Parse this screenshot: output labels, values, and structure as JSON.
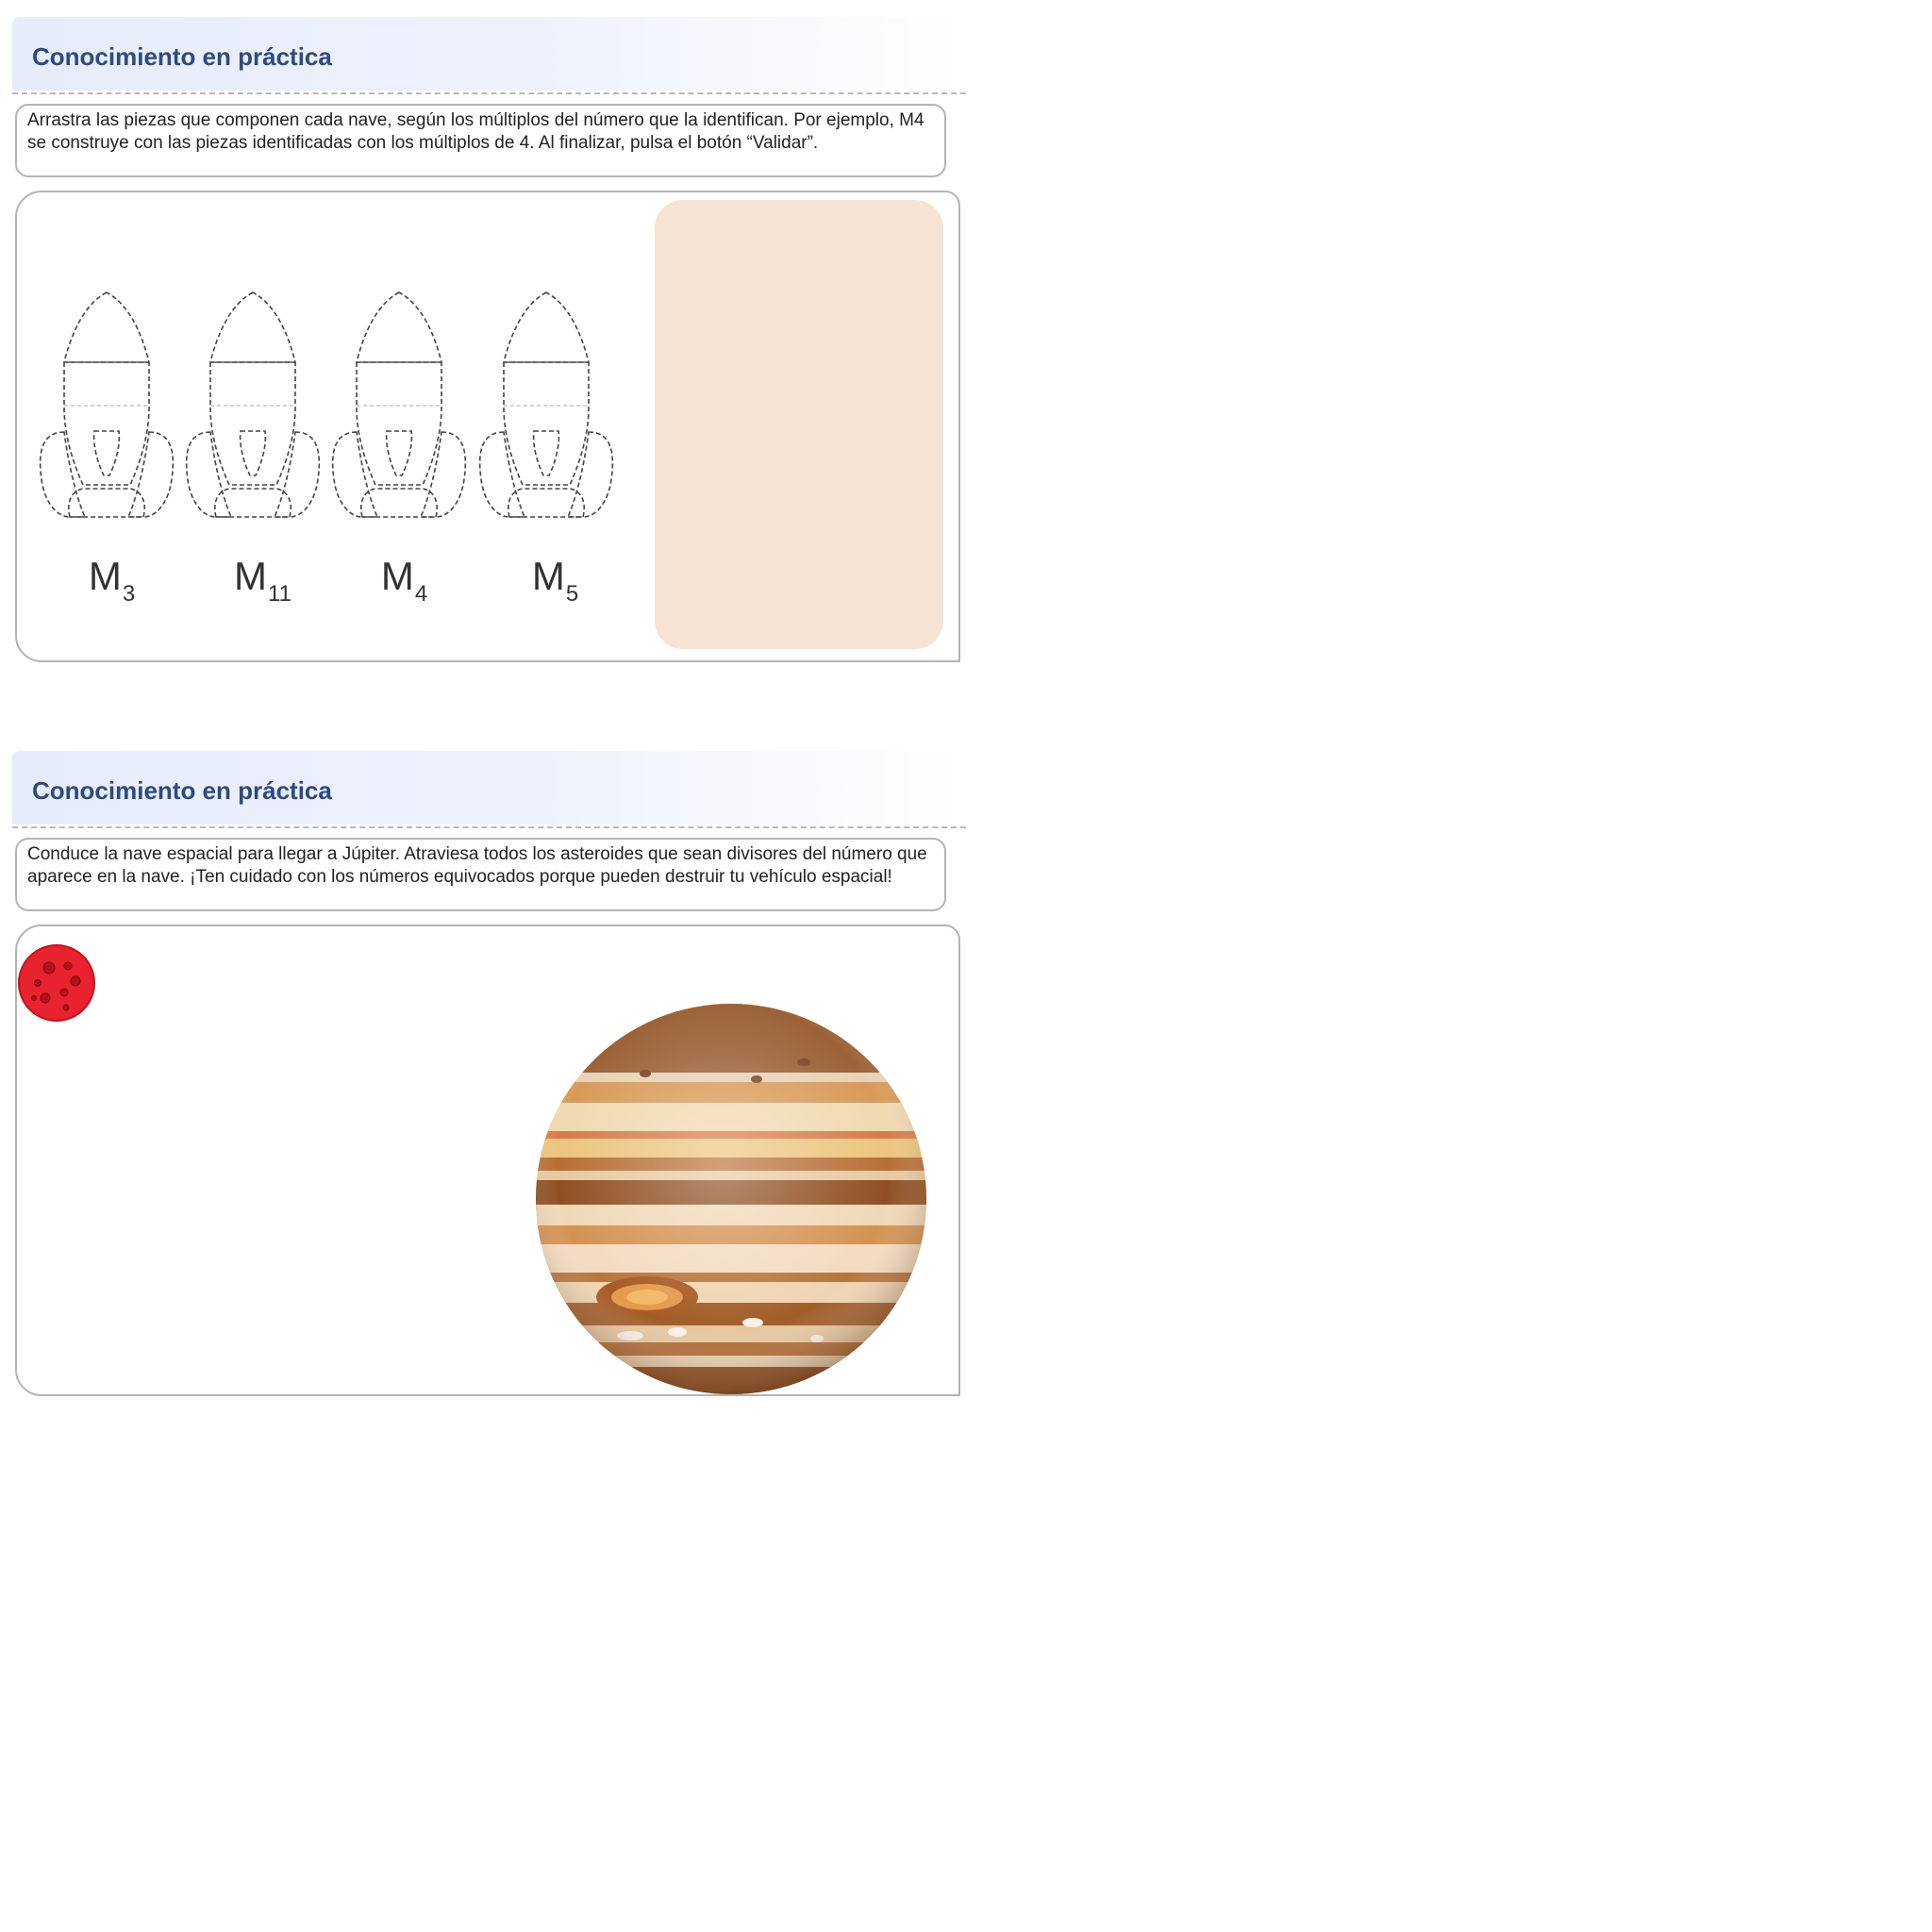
{
  "activity_1": {
    "title": "Conocimiento en práctica",
    "instructions": "Arrastra las piezas que componen cada nave, según los múltiplos del número que la identifican. Por ejemplo, M4 se construye con las piezas identificadas con los múltiplos de 4. Al finalizar, pulsa el botón “Validar”.",
    "rockets": [
      {
        "main": "M",
        "sub": "3"
      },
      {
        "main": "M",
        "sub": "11"
      },
      {
        "main": "M",
        "sub": "4"
      },
      {
        "main": "M",
        "sub": "5"
      }
    ],
    "tray_color": "#f7e3d3"
  },
  "activity_2": {
    "title": "Conocimiento en práctica",
    "instructions": "Conduce la nave espacial para llegar a Júpiter. Atraviesa todos los asteroides que sean divisores del número que aparece en la nave. ¡Ten cuidado con los números equivocados porque pueden destruir tu vehículo espacial!",
    "asteroid_icon": "red-asteroid-icon",
    "planet_icon": "jupiter-icon"
  },
  "colors": {
    "title": "#2f4a7e",
    "border": "#b4b4b4",
    "asteroid": "#e8232f"
  }
}
